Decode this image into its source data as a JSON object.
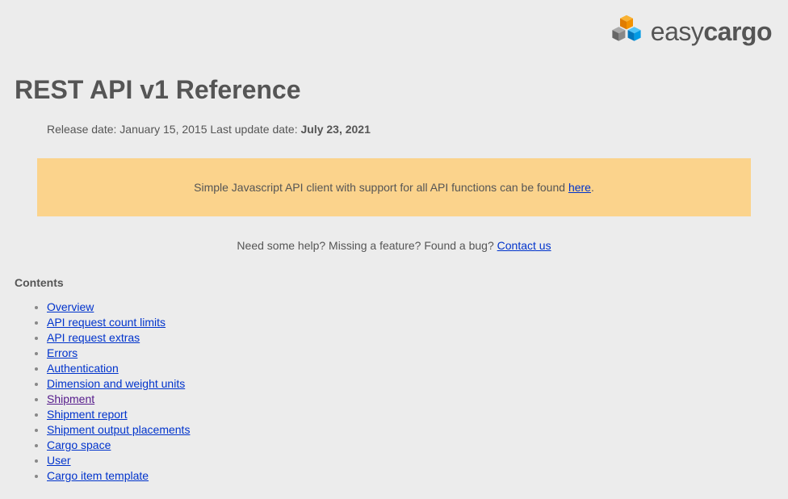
{
  "logo": {
    "light": "easy",
    "bold": "cargo"
  },
  "title": "REST API v1 Reference",
  "release_label": "Release date: ",
  "release_date": "January 15, 2015",
  "update_label": " Last update date: ",
  "update_date": "July 23, 2021",
  "banner_prefix": "Simple Javascript API client with support for all API functions can be found ",
  "banner_link": "here",
  "banner_suffix": ".",
  "help_prefix": "Need some help? Missing a feature? Found a bug? ",
  "help_link": "Contact us",
  "contents_title": "Contents",
  "contents": [
    "Overview",
    "API request count limits",
    "API request extras",
    "Errors",
    "Authentication",
    "Dimension and weight units",
    "Shipment",
    "Shipment report",
    "Shipment output placements",
    "Cargo space",
    "User",
    "Cargo item template"
  ]
}
